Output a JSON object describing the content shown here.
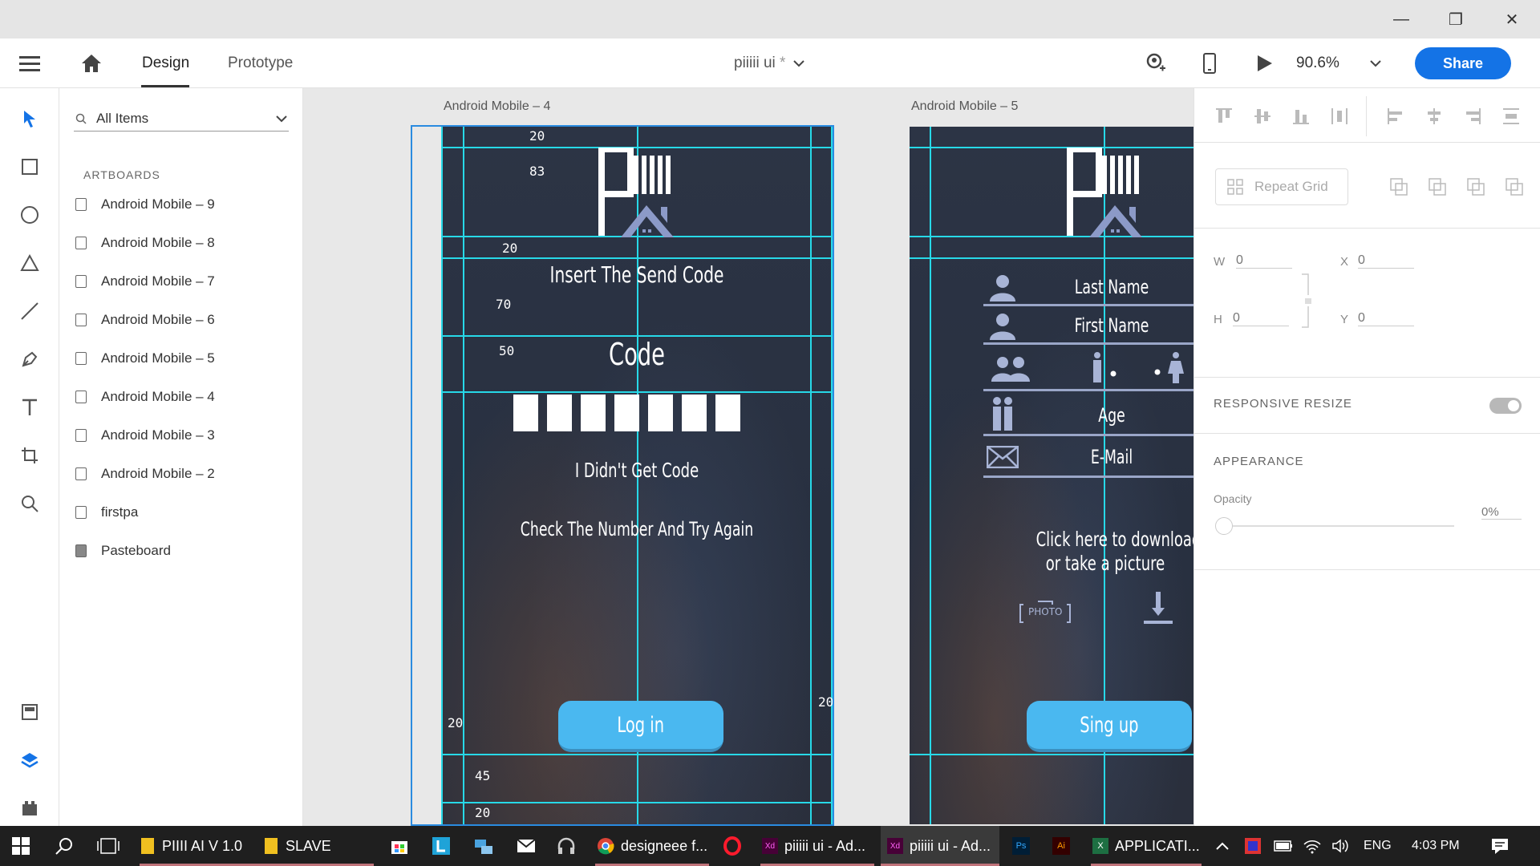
{
  "window": {
    "minimize": "—",
    "restore": "❐",
    "close": "✕"
  },
  "header": {
    "tabs": [
      {
        "label": "Design"
      },
      {
        "label": "Prototype"
      }
    ],
    "doc_title": "piiiii ui",
    "doc_modified_mark": "*",
    "zoom": "90.6%",
    "share_label": "Share"
  },
  "layers": {
    "search_value": "All Items",
    "section_title": "ARTBOARDS",
    "items": [
      {
        "label": "Android Mobile – 9"
      },
      {
        "label": "Android Mobile – 8"
      },
      {
        "label": "Android Mobile – 7"
      },
      {
        "label": "Android Mobile – 6"
      },
      {
        "label": "Android Mobile – 5"
      },
      {
        "label": "Android Mobile – 4"
      },
      {
        "label": "Android Mobile – 3"
      },
      {
        "label": "Android Mobile – 2"
      },
      {
        "label": "firstpa"
      },
      {
        "label": "Pasteboard"
      }
    ]
  },
  "artboard4": {
    "title": "Android Mobile – 4",
    "heading": "Insert The Send Code",
    "code_label": "Code",
    "code_boxes": 7,
    "no_code": "I Didn't Get Code",
    "retry": "Check The Number And Try Again",
    "login_label": "Log in",
    "spacing": {
      "s20a": "20",
      "s83": "83",
      "s20b": "20",
      "s70": "70",
      "s50": "50",
      "s20c": "20",
      "s20d": "20",
      "s45": "45",
      "s20e": "20"
    }
  },
  "artboard5": {
    "title": "Android Mobile – 5",
    "fields": [
      {
        "label": "Last Name"
      },
      {
        "label": "First  Name"
      },
      {
        "label": ""
      },
      {
        "label": "Age"
      },
      {
        "label": "E-Mail"
      }
    ],
    "picture_line1": "Click here to download",
    "picture_line2": "or take a picture",
    "photo_label": "PHOTO",
    "signup_label": "Sing up"
  },
  "props": {
    "repeat_grid": "Repeat Grid",
    "w_label": "W",
    "w_value": "0",
    "h_label": "H",
    "h_value": "0",
    "x_label": "X",
    "x_value": "0",
    "y_label": "Y",
    "y_value": "0",
    "responsive_resize": "RESPONSIVE RESIZE",
    "appearance": "APPEARANCE",
    "opacity_label": "Opacity",
    "opacity_value": "0%"
  },
  "taskbar": {
    "apps": [
      {
        "label": "PIIII AI V 1.0"
      },
      {
        "label": "SLAVE"
      },
      {
        "label": "designeee f..."
      },
      {
        "label": "piiiii ui - Ad..."
      },
      {
        "label": "piiiii ui - Ad..."
      },
      {
        "label": "APPLICATI..."
      }
    ],
    "lang": "ENG",
    "time": "4:03 PM"
  },
  "colors": {
    "accent": "#1473e6",
    "guide": "#27d9e8",
    "button": "#4ab8f0",
    "artboard_bg": "#2b3242"
  }
}
